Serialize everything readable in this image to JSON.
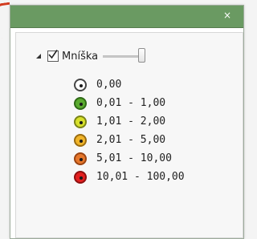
{
  "window": {
    "close_glyph": "×"
  },
  "layer": {
    "label": "Mníška",
    "checked": true,
    "opacity": 1.0
  },
  "legend": [
    {
      "label": "0,00",
      "color": "#ffffff",
      "border": "#444444"
    },
    {
      "label": "0,01 - 1,00",
      "color": "#5aab2f",
      "border": "#2f6a16"
    },
    {
      "label": "1,01 - 2,00",
      "color": "#d7e02b",
      "border": "#7a8317"
    },
    {
      "label": "2,01 - 5,00",
      "color": "#f0b429",
      "border": "#9a6c10"
    },
    {
      "label": "5,01 - 10,00",
      "color": "#e6772b",
      "border": "#9a4412"
    },
    {
      "label": "10,01 - 100,00",
      "color": "#e32020",
      "border": "#8d1010"
    }
  ]
}
